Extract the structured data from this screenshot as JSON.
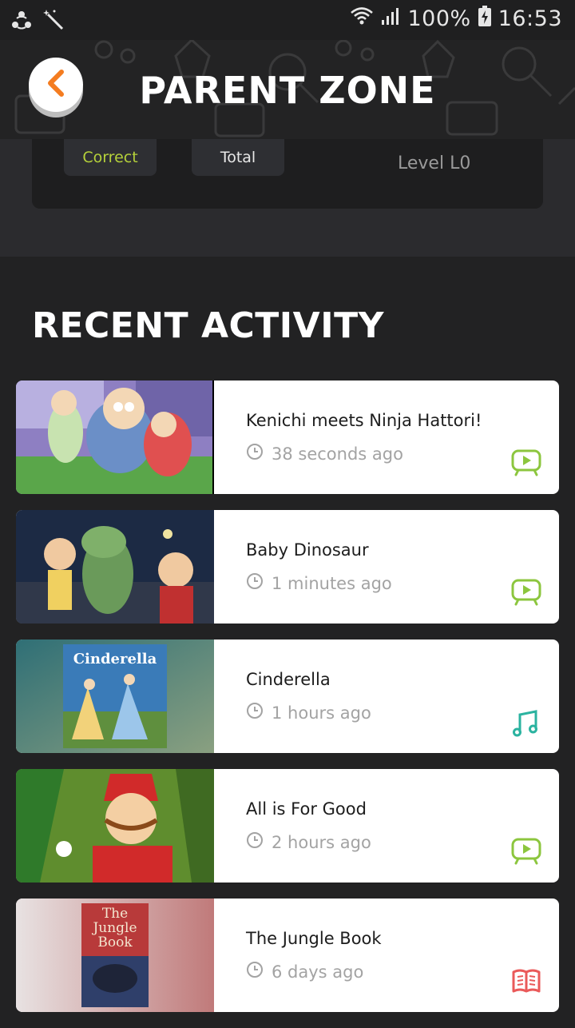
{
  "status_bar": {
    "battery": "100%",
    "time": "16:53"
  },
  "header": {
    "title": "PARENT ZONE"
  },
  "stats": {
    "correct_label": "Correct",
    "total_label": "Total",
    "level": "Level L0"
  },
  "recent": {
    "title": "RECENT ACTIVITY",
    "items": [
      {
        "title": "Kenichi meets Ninja Hattori!",
        "time": "38 seconds ago",
        "type": "video-icon"
      },
      {
        "title": "Baby Dinosaur",
        "time": "1 minutes ago",
        "type": "video-icon"
      },
      {
        "title": "Cinderella",
        "time": "1 hours ago",
        "type": "music-icon",
        "thumb_text": "Cinderella"
      },
      {
        "title": "All is For Good",
        "time": "2 hours ago",
        "type": "video-icon"
      },
      {
        "title": "The Jungle Book",
        "time": "6 days ago",
        "type": "book-icon",
        "thumb_text": "The Jungle Book"
      }
    ]
  },
  "colors": {
    "video": "#8cc63e",
    "music": "#2bb3a0",
    "book": "#ea5a5a",
    "back_arrow": "#f47c20",
    "correct": "#b5d13a"
  }
}
